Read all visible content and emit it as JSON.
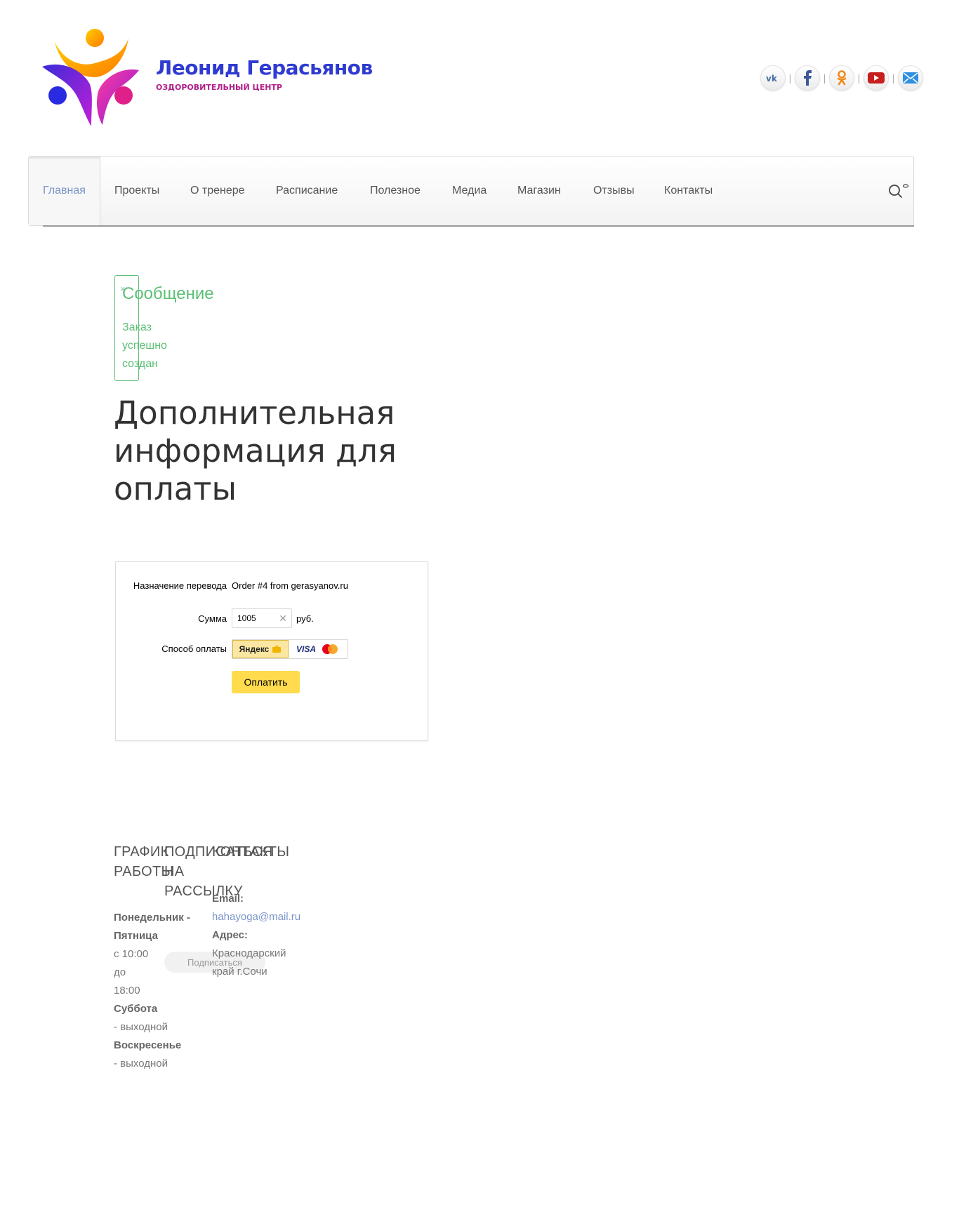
{
  "header": {
    "brand_name": "Леонид Герасьянов",
    "brand_subtitle": "ОЗДОРОВИТЕЛЬНЫЙ ЦЕНТР",
    "social": [
      {
        "icon": "vk-icon"
      },
      {
        "icon": "facebook-icon"
      },
      {
        "icon": "odnoklassniki-icon"
      },
      {
        "icon": "youtube-icon"
      },
      {
        "icon": "mail-icon"
      }
    ],
    "separator": "|"
  },
  "nav": {
    "items": [
      "Главная",
      "Проекты",
      "О тренере",
      "Расписание",
      "Полезное",
      "Медиа",
      "Магазин",
      "Отзывы",
      "Контакты"
    ],
    "active_index": 0,
    "active_color": "#7b95c9"
  },
  "message": {
    "close": "×",
    "title": "Сообщение",
    "text": "Заказ успешно создан",
    "color": "#5cbf75"
  },
  "heading": "Дополнительная информация для оплаты",
  "payment": {
    "purpose_label": "Назначение перевода",
    "purpose_value": "Order #4 from gerasyanov.ru",
    "sum_label": "Сумма",
    "sum_value": "1005",
    "currency": "руб.",
    "method_label": "Способ оплаты",
    "method_yandex": "Яндекс",
    "method_visa": "VISA",
    "pay_button": "Оплатить",
    "button_color": "#ffdb4d"
  },
  "footer": {
    "schedule_title": "ГРАФИК РАБОТЫ",
    "schedule": {
      "weekdays_label": "Понедельник - Пятница",
      "weekdays_hours": "с 10:00 до 18:00",
      "saturday_label": "Суббота",
      "saturday_value": "- выходной",
      "sunday_label": "Воскресенье",
      "sunday_value": "- выходной"
    },
    "subscribe_title": "ПОДПИСАТЬСЯ НА РАССЫЛКУ",
    "subscribe_button": "Подписаться",
    "contacts_title": "КОНТАКТЫ",
    "contacts": {
      "email_label": "Email:",
      "email": "hahayoga@mail.ru",
      "address_label": "Адрес:",
      "address": "Краснодарский край г.Сочи"
    }
  }
}
